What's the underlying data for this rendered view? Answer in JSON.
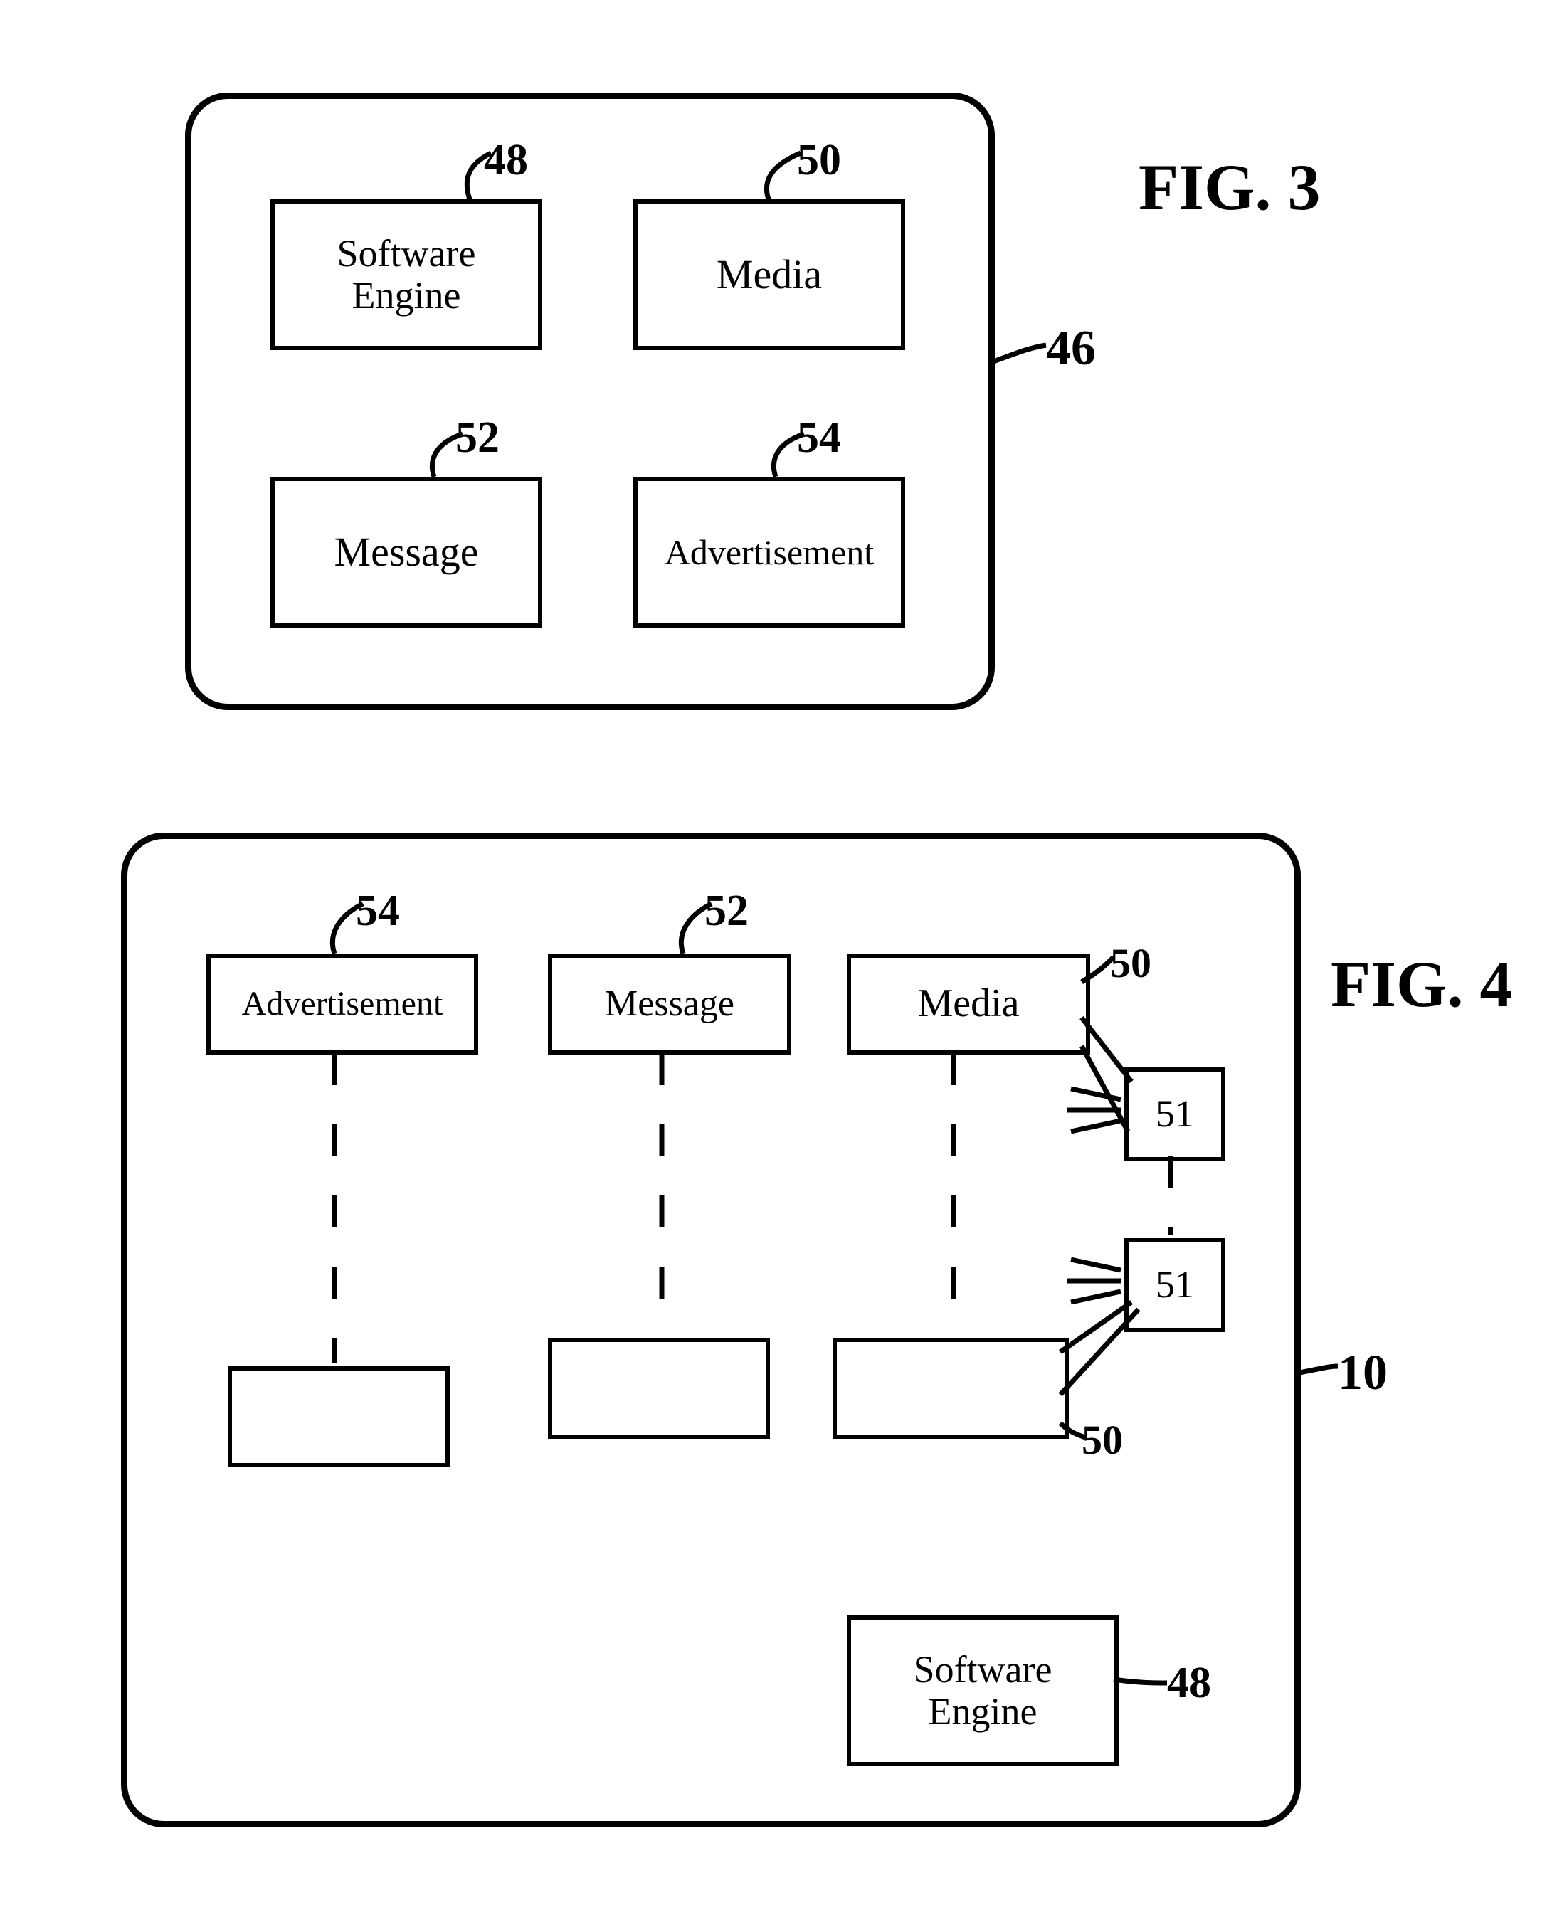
{
  "figures": {
    "fig3": {
      "title": "FIG. 3",
      "container_ref": "46",
      "boxes": {
        "software_engine": {
          "label": "Software\nEngine",
          "ref": "48"
        },
        "media": {
          "label": "Media",
          "ref": "50"
        },
        "message": {
          "label": "Message",
          "ref": "52"
        },
        "advertisement": {
          "label": "Advertisement",
          "ref": "54"
        }
      }
    },
    "fig4": {
      "title": "FIG. 4",
      "container_ref": "10",
      "boxes": {
        "advertisement": {
          "label": "Advertisement",
          "ref": "54"
        },
        "message": {
          "label": "Message",
          "ref": "52"
        },
        "media_top": {
          "label": "Media",
          "ref": "50"
        },
        "media_bottom": {
          "label": "",
          "ref": "50"
        },
        "software_engine": {
          "label": "Software\nEngine",
          "ref": "48"
        },
        "satellite_a": {
          "label": "51",
          "ref": "51"
        },
        "satellite_b": {
          "label": "51",
          "ref": "51"
        }
      }
    }
  }
}
